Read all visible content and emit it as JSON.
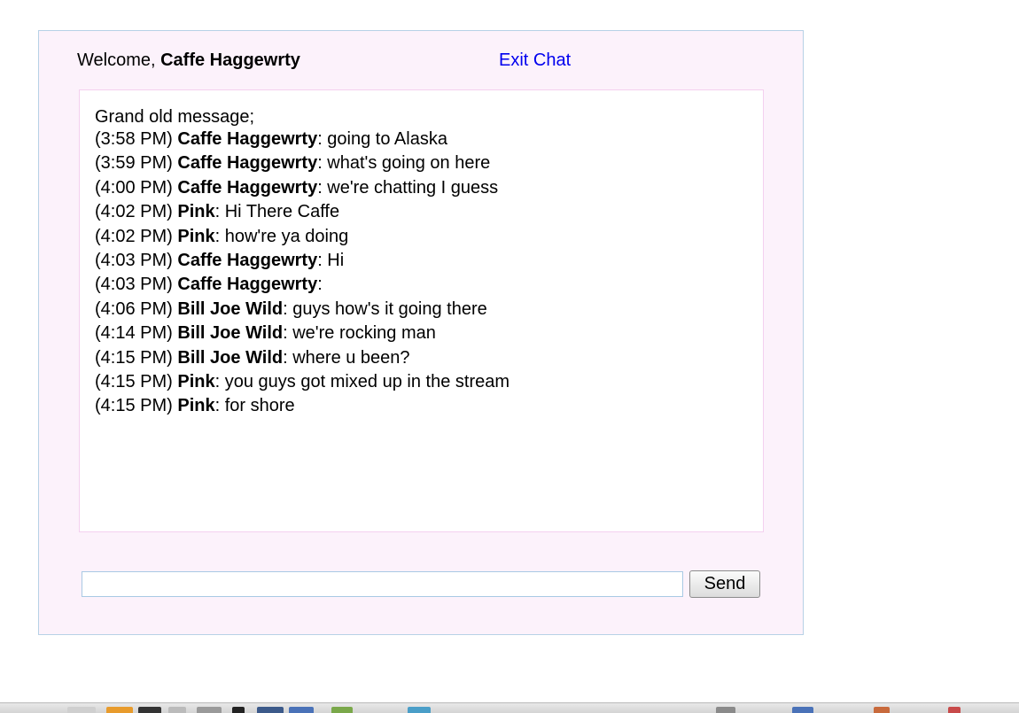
{
  "header": {
    "welcome_prefix": "Welcome, ",
    "username": "Caffe Haggewrty",
    "exit_label": "Exit Chat"
  },
  "chat": {
    "intro": "Grand old message;",
    "messages": [
      {
        "time": "(3:58 PM)",
        "sender": "Caffe Haggewrty",
        "text": ": going to Alaska"
      },
      {
        "time": "(3:59 PM)",
        "sender": "Caffe Haggewrty",
        "text": ": what's going on here"
      },
      {
        "time": "(4:00 PM)",
        "sender": "Caffe Haggewrty",
        "text": ": we're chatting I guess"
      },
      {
        "time": "(4:02 PM)",
        "sender": "Pink",
        "text": ": Hi There Caffe"
      },
      {
        "time": "(4:02 PM)",
        "sender": "Pink",
        "text": ": how're ya doing"
      },
      {
        "time": "(4:03 PM)",
        "sender": "Caffe Haggewrty",
        "text": ": Hi"
      },
      {
        "time": "(4:03 PM)",
        "sender": "Caffe Haggewrty",
        "text": ":"
      },
      {
        "time": "(4:06 PM)",
        "sender": "Bill Joe Wild",
        "text": ": guys how's it going there"
      },
      {
        "time": "(4:14 PM)",
        "sender": "Bill Joe Wild",
        "text": ": we're rocking man"
      },
      {
        "time": "(4:15 PM)",
        "sender": "Bill Joe Wild",
        "text": ": where u been?"
      },
      {
        "time": "(4:15 PM)",
        "sender": "Pink",
        "text": ": you guys got mixed up in the stream"
      },
      {
        "time": "(4:15 PM)",
        "sender": "Pink",
        "text": ": for shore"
      }
    ]
  },
  "composer": {
    "input_value": "",
    "send_label": "Send"
  },
  "colors": {
    "panel_background": "#fcf2fb",
    "panel_border": "#b7d1e6",
    "chat_border": "#f4d0ef",
    "link": "#0000ee"
  },
  "taskbar": {
    "icons": [
      {
        "name": "window-icon",
        "color": "#cfcfcf"
      },
      {
        "name": "browser-icon",
        "color": "#e89b2c"
      },
      {
        "name": "terminal-icon",
        "color": "#333333"
      },
      {
        "name": "file-icon",
        "color": "#bbbbbb"
      },
      {
        "name": "notepad-icon",
        "color": "#9a9a9a"
      },
      {
        "name": "penguin-icon",
        "color": "#222222"
      },
      {
        "name": "shield-icon",
        "color": "#3c5a8a"
      },
      {
        "name": "network-icon",
        "color": "#4a72b8"
      },
      {
        "name": "palette-icon",
        "color": "#7aa84a"
      },
      {
        "name": "app-icon",
        "color": "#4a9ec8"
      },
      {
        "name": "display-icon",
        "color": "#8a8a8a"
      },
      {
        "name": "monitor-icon",
        "color": "#4a72b8"
      },
      {
        "name": "speaker-icon",
        "color": "#c86a3c"
      },
      {
        "name": "power-icon",
        "color": "#c84a4a"
      }
    ]
  }
}
